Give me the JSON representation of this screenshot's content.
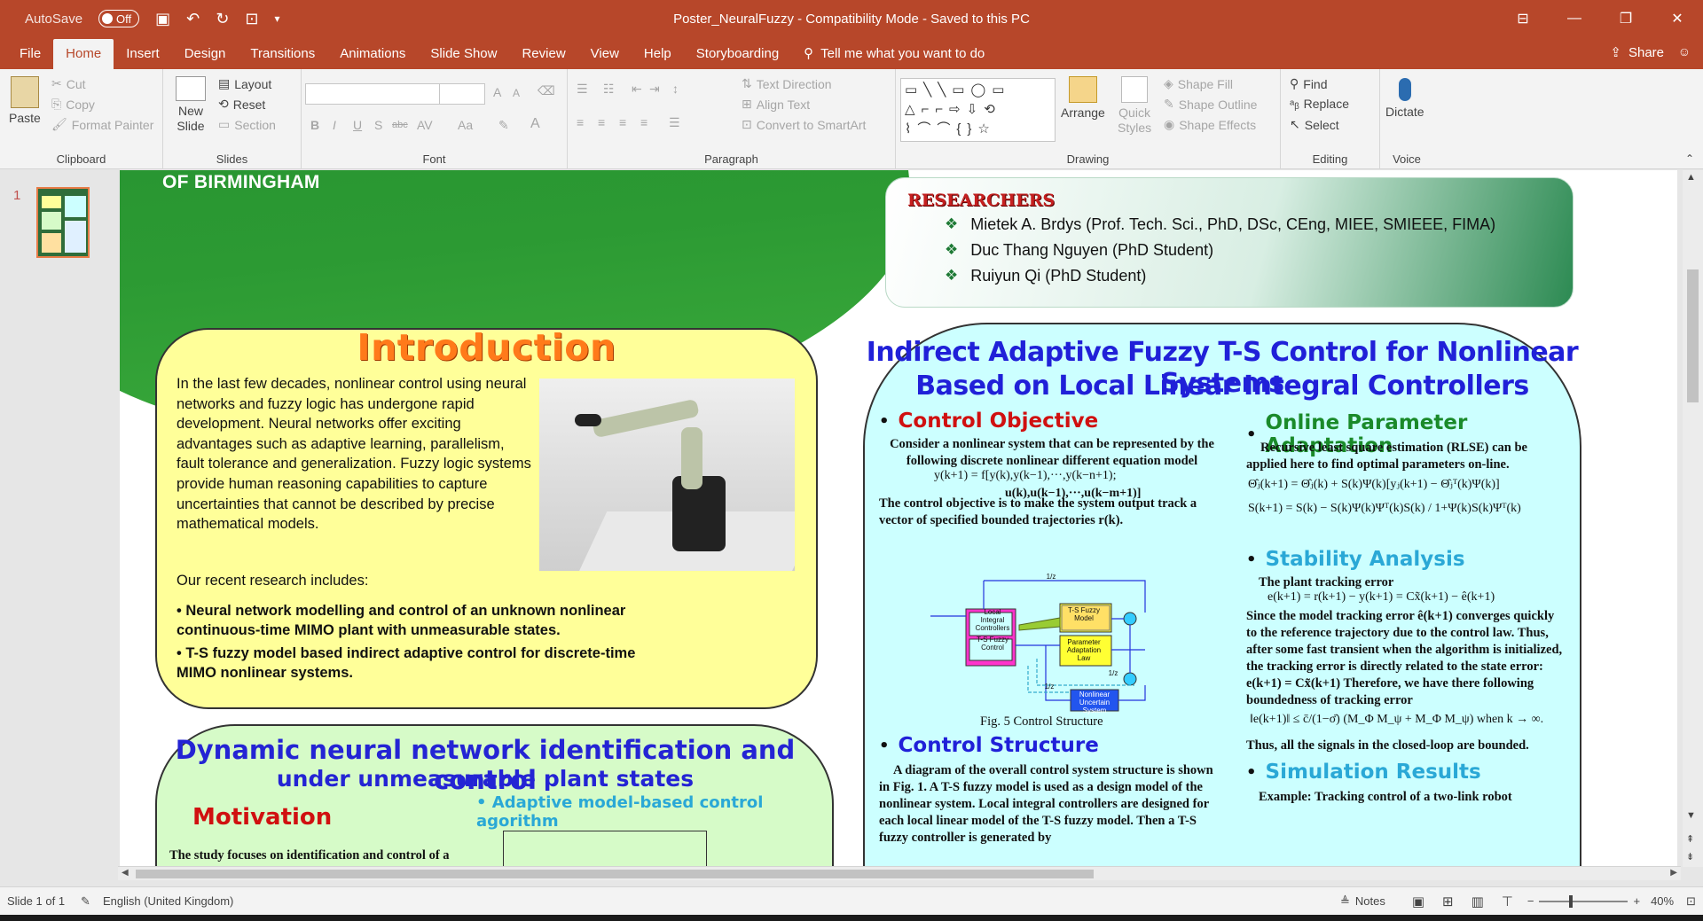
{
  "window": {
    "autosave_label": "AutoSave",
    "autosave_state": "Off",
    "title": "Poster_NeuralFuzzy  -  Compatibility Mode  -  Saved to this PC",
    "share": "Share"
  },
  "tabs": [
    "File",
    "Home",
    "Insert",
    "Design",
    "Transitions",
    "Animations",
    "Slide Show",
    "Review",
    "View",
    "Help",
    "Storyboarding"
  ],
  "tell_me": "Tell me what you want to do",
  "ribbon": {
    "clipboard": {
      "paste": "Paste",
      "cut": "Cut",
      "copy": "Copy",
      "format_painter": "Format Painter",
      "label": "Clipboard"
    },
    "slides": {
      "new_slide_line1": "New",
      "new_slide_line2": "Slide",
      "layout": "Layout",
      "reset": "Reset",
      "section": "Section",
      "label": "Slides"
    },
    "font": {
      "label": "Font",
      "bold": "B",
      "italic": "I",
      "underline": "U",
      "shadow": "S",
      "strike": "abc",
      "spacing": "AV",
      "case": "Aa",
      "color": "A",
      "grow": "A",
      "shrink": "A"
    },
    "paragraph": {
      "label": "Paragraph",
      "text_direction": "Text Direction",
      "align_text": "Align Text",
      "convert_smartart": "Convert to SmartArt"
    },
    "drawing": {
      "label": "Drawing",
      "arrange": "Arrange",
      "quick_styles_line1": "Quick",
      "quick_styles_line2": "Styles",
      "shape_fill": "Shape Fill",
      "shape_outline": "Shape Outline",
      "shape_effects": "Shape Effects",
      "shapes_row1": "▭╲╲▭◯▭",
      "shapes_row2": "△⌐⌐⇨⇩⟲",
      "shapes_row3": "⌇⌒⌒{}☆"
    },
    "editing": {
      "label": "Editing",
      "find": "Find",
      "replace": "Replace",
      "select": "Select"
    },
    "voice": {
      "label": "Voice",
      "dictate": "Dictate"
    }
  },
  "thumbnails": [
    {
      "number": "1"
    }
  ],
  "slide": {
    "university": "OF BIRMINGHAM",
    "researchers": {
      "title": "RESEARCHERS",
      "items": [
        "Mietek A. Brdys (Prof. Tech. Sci., PhD, DSc, CEng, MIEE, SMIEEE, FIMA)",
        "Duc Thang Nguyen (PhD Student)",
        "Ruiyun Qi (PhD Student)"
      ]
    },
    "intro": {
      "title": "Introduction",
      "text": "In the last few decades, nonlinear control using neural networks and fuzzy logic has undergone rapid development. Neural networks offer exciting advantages such as adaptive learning, parallelism, fault tolerance and generalization. Fuzzy logic systems provide human reasoning capabilities to capture uncertainties that cannot be described by precise mathematical models.",
      "research_head": "Our recent research includes:",
      "research_items": [
        "• Neural network modelling and control of an unknown nonlinear continuous-time MIMO plant with unmeasurable states.",
        "• T-S fuzzy model based indirect adaptive control for discrete-time MIMO nonlinear systems."
      ]
    },
    "dnn": {
      "title_line1": "Dynamic neural network identification and control",
      "title_line2": "under unmeasurable plant states",
      "motivation": "Motivation",
      "adaptive": "Adaptive model-based control agorithm",
      "text": "The study focuses on identification and control of a"
    },
    "control": {
      "title_line1": "Indirect Adaptive Fuzzy T-S Control for Nonlinear Systems",
      "title_line2": "Based on Local Linear Integral Controllers",
      "objective_h": "Control Objective",
      "objective_text": "Consider a nonlinear system that can be represented by the following discrete nonlinear different equation model",
      "objective_eq1": "y(k+1) = f[y(k),y(k−1),···,y(k−n+1);",
      "objective_eq2": "u(k),u(k−1),···,u(k−m+1)]",
      "objective_text2": "The control objective is to make the system output  track a vector of specified bounded trajectories r(k).",
      "fig_caption": "Fig. 5 Control Structure",
      "structure_h": "Control Structure",
      "structure_text": "A diagram of the overall control system structure is shown in Fig. 1. A T-S fuzzy model is used as a design model of the nonlinear system. Local integral controllers are designed for each local linear model of the T-S fuzzy model. Then a T-S fuzzy controller is generated by",
      "online_h": "Online Parameter Adaptation",
      "online_text": "Recursive least square estimation (RLSE) can be applied here to find optimal parameters on-line.",
      "online_eq1": "Θ̂ⱼ(k+1) = Θ̂ⱼ(k) + S(k)Ψ(k)[yⱼ(k+1) − Θ̂ⱼᵀ(k)Ψ(k)]",
      "online_eq2": "S(k+1) = S(k) − S(k)Ψ(k)Ψᵀ(k)S(k) / 1+Ψ(k)S(k)Ψᵀ(k)",
      "stability_h": "Stability Analysis",
      "stab_text1": "The plant tracking error",
      "stab_eq1": "e(k+1) = r(k+1) − y(k+1) = Cx̃(k+1) − ê(k+1)",
      "stab_text2": "Since the model tracking error ê(k+1) converges quickly to the reference trajectory due to the control law. Thus, after some fast transient when the algorithm is initialized, the tracking error is directly related to the state error:  e(k+1) = Cx̃(k+1) Therefore, we have there following boundedness of tracking error",
      "stab_eq2": "‖e(k+1)‖ ≤ c̄/(1−σ̄) (M_Φ M_ψ + M_Φ M_ψ)    when k → ∞.",
      "stab_text3": "Thus, all the signals in the closed-loop are bounded.",
      "sim_h": "Simulation Results",
      "sim_text": "Example: Tracking control of a two-link robot",
      "diag_labels": {
        "local": "Local Integral Controllers",
        "tsfc": "T-S Fuzzy Control",
        "tsfm": "T-S Fuzzy Model",
        "param": "Parameter Adaptation Law",
        "plant": "Nonlinear Uncertain System",
        "z1": "1/z",
        "z2": "1/z",
        "z3": "1/z"
      }
    }
  },
  "status": {
    "slide_of": "Slide 1 of 1",
    "language": "English (United Kingdom)",
    "notes": "Notes",
    "zoom": "40%"
  },
  "colors": {
    "accent": "#b7472a",
    "intro_bg": "#ffff99",
    "control_bg": "#ccffff",
    "dnn_bg": "#d6fbc8",
    "header_green": "#2c9a33"
  }
}
